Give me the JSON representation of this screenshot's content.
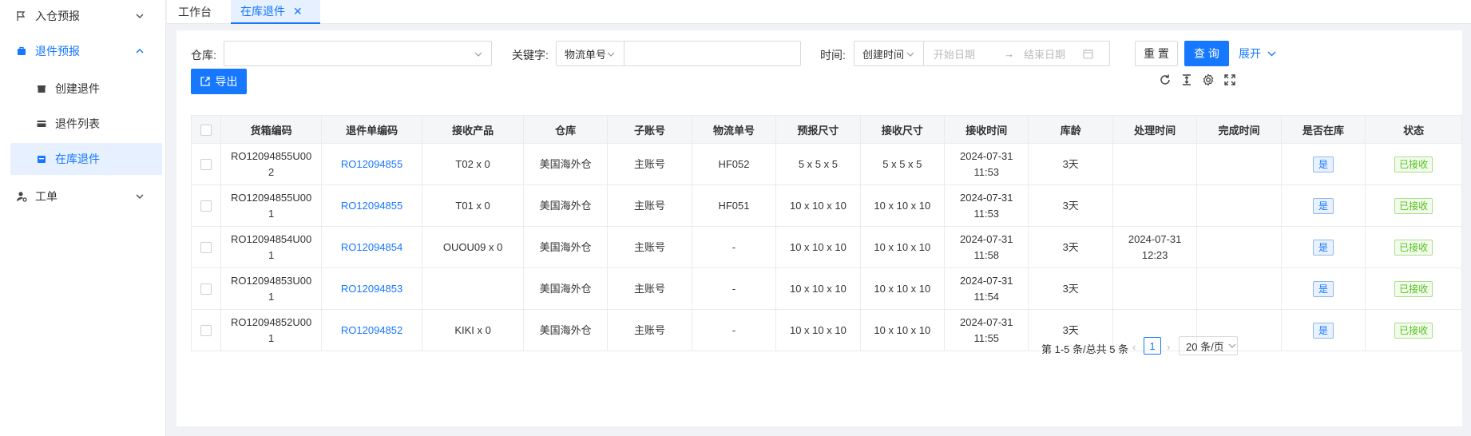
{
  "sidebar": {
    "items": [
      {
        "label": "入仓预报",
        "icon": "flag-icon"
      },
      {
        "label": "退件预报",
        "icon": "bag-icon"
      },
      {
        "label": "创建退件",
        "icon": "box-icon"
      },
      {
        "label": "退件列表",
        "icon": "card-icon"
      },
      {
        "label": "在库退件",
        "icon": "store-icon"
      },
      {
        "label": "工单",
        "icon": "user-settings-icon"
      }
    ]
  },
  "tabs": [
    {
      "label": "工作台"
    },
    {
      "label": "在库退件"
    }
  ],
  "filters": {
    "warehouse_label": "仓库:",
    "warehouse_value": "",
    "keyword_label": "关键字:",
    "keyword_type": "物流单号",
    "keyword_value": "",
    "time_label": "时间:",
    "time_type": "创建时间",
    "start_placeholder": "开始日期",
    "end_placeholder": "结束日期",
    "range_sep": "→"
  },
  "actions": {
    "reset": "重 置",
    "search": "查 询",
    "expand": "展开",
    "export": "导出"
  },
  "table": {
    "columns": [
      "货箱编码",
      "退件单编码",
      "接收产品",
      "仓库",
      "子账号",
      "物流单号",
      "预报尺寸",
      "接收尺寸",
      "接收时间",
      "库龄",
      "处理时间",
      "完成时间",
      "是否在库",
      "状态"
    ],
    "rows": [
      {
        "box_code_1": "RO12094855U00",
        "box_code_2": "2",
        "return_code": "RO12094855",
        "product": "T02 x 0",
        "warehouse": "美国海外仓",
        "sub_account": "主账号",
        "tracking": "HF052",
        "forecast_size": "5 x 5 x 5",
        "recv_size": "5 x 5 x 5",
        "recv_date": "2024-07-31",
        "recv_time": "11:53",
        "age": "3天",
        "proc_date": "",
        "proc_time": "",
        "done": "",
        "in_stock": "是",
        "status": "已接收"
      },
      {
        "box_code_1": "RO12094855U00",
        "box_code_2": "1",
        "return_code": "RO12094855",
        "product": "T01 x 0",
        "warehouse": "美国海外仓",
        "sub_account": "主账号",
        "tracking": "HF051",
        "forecast_size": "10 x 10 x 10",
        "recv_size": "10 x 10 x 10",
        "recv_date": "2024-07-31",
        "recv_time": "11:53",
        "age": "3天",
        "proc_date": "",
        "proc_time": "",
        "done": "",
        "in_stock": "是",
        "status": "已接收"
      },
      {
        "box_code_1": "RO12094854U00",
        "box_code_2": "1",
        "return_code": "RO12094854",
        "product": "OUOU09 x 0",
        "warehouse": "美国海外仓",
        "sub_account": "主账号",
        "tracking": "-",
        "forecast_size": "10 x 10 x 10",
        "recv_size": "10 x 10 x 10",
        "recv_date": "2024-07-31",
        "recv_time": "11:58",
        "age": "3天",
        "proc_date": "2024-07-31",
        "proc_time": "12:23",
        "done": "",
        "in_stock": "是",
        "status": "已接收"
      },
      {
        "box_code_1": "RO12094853U00",
        "box_code_2": "1",
        "return_code": "RO12094853",
        "product": "",
        "warehouse": "美国海外仓",
        "sub_account": "主账号",
        "tracking": "-",
        "forecast_size": "10 x 10 x 10",
        "recv_size": "10 x 10 x 10",
        "recv_date": "2024-07-31",
        "recv_time": "11:54",
        "age": "3天",
        "proc_date": "",
        "proc_time": "",
        "done": "",
        "in_stock": "是",
        "status": "已接收"
      },
      {
        "box_code_1": "RO12094852U00",
        "box_code_2": "1",
        "return_code": "RO12094852",
        "product": "KIKI x 0",
        "warehouse": "美国海外仓",
        "sub_account": "主账号",
        "tracking": "-",
        "forecast_size": "10 x 10 x 10",
        "recv_size": "10 x 10 x 10",
        "recv_date": "2024-07-31",
        "recv_time": "11:55",
        "age": "3天",
        "proc_date": "",
        "proc_time": "",
        "done": "",
        "in_stock": "是",
        "status": "已接收"
      }
    ]
  },
  "pagination": {
    "summary": "第 1-5 条/总共 5 条",
    "current": "1",
    "page_size": "20 条/页"
  },
  "colors": {
    "primary": "#1677ff",
    "success": "#52c41a"
  }
}
